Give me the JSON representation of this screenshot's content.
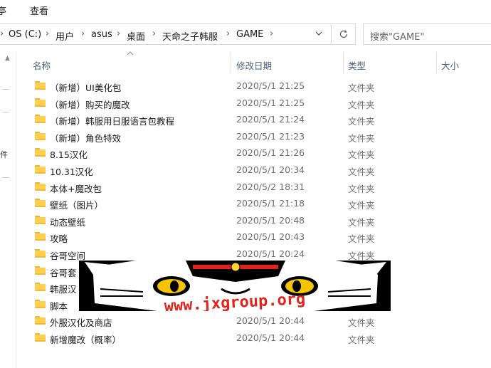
{
  "menubar": {
    "items": [
      "亭",
      "查看"
    ]
  },
  "address": {
    "crumbs": [
      "OS (C:)",
      "用户",
      "asus",
      "桌面",
      "天命之子韩服",
      "GAME"
    ],
    "separator": "›"
  },
  "search": {
    "placeholder": "搜索\"GAME\""
  },
  "columns": {
    "name": "名称",
    "date": "修改日期",
    "type": "类型",
    "size": "大小"
  },
  "left_pane": {
    "glyph": "件"
  },
  "files": [
    {
      "name": "（新增）UI美化包",
      "date": "2020/5/1 21:25",
      "type": "文件夹"
    },
    {
      "name": "（新增）购买的魔改",
      "date": "2020/5/1 21:25",
      "type": "文件夹"
    },
    {
      "name": "（新增）韩服用日服语言包教程",
      "date": "2020/5/1 21:24",
      "type": "文件夹"
    },
    {
      "name": "（新增）角色特效",
      "date": "2020/5/1 21:23",
      "type": "文件夹"
    },
    {
      "name": "8.15汉化",
      "date": "2020/5/1 21:26",
      "type": "文件夹"
    },
    {
      "name": "10.31汉化",
      "date": "2020/5/1 20:34",
      "type": "文件夹"
    },
    {
      "name": "本体+魔改包",
      "date": "2020/5/2 18:31",
      "type": "文件夹"
    },
    {
      "name": "壁纸（图片）",
      "date": "2020/5/1 21:18",
      "type": "文件夹"
    },
    {
      "name": "动态壁纸",
      "date": "2020/5/1 20:48",
      "type": "文件夹"
    },
    {
      "name": "攻略",
      "date": "2020/5/1 20:43",
      "type": "文件夹"
    },
    {
      "name": "谷哥空间",
      "date": "2020/5/1 20:24",
      "type": "文件夹"
    },
    {
      "name": "谷哥套",
      "date": "",
      "type": ""
    },
    {
      "name": "韩服汉",
      "date": "",
      "type": ""
    },
    {
      "name": "脚本",
      "date": "",
      "type": ""
    },
    {
      "name": "外服汉化及商店",
      "date": "2020/5/1 20:44",
      "type": "文件夹"
    },
    {
      "name": "新增魔改（概率）",
      "date": "2020/5/1 20:44",
      "type": "文件夹"
    }
  ],
  "watermark": {
    "text": "www.jxgroup.org"
  },
  "colors": {
    "header_text": "#4c607a",
    "folder": "#ffcf4f",
    "muted_text": "#6d6d6d"
  }
}
